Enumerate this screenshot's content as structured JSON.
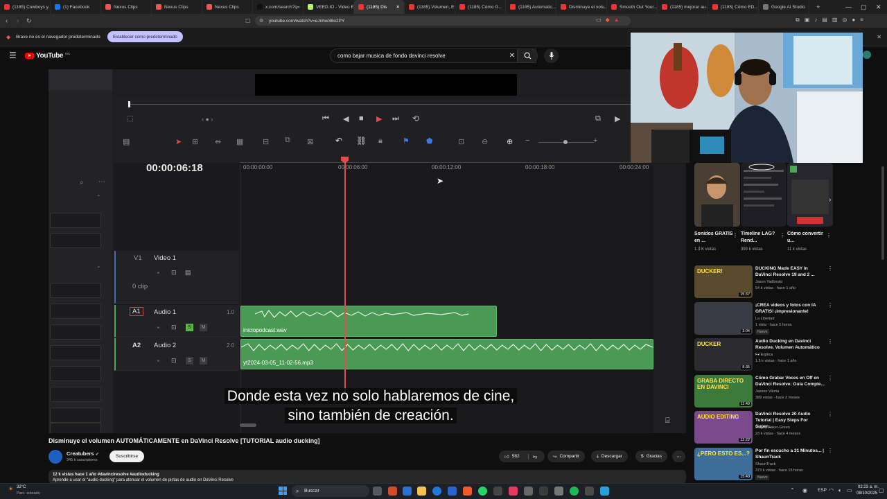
{
  "tabs": [
    {
      "label": "(1185) Cowboys y...",
      "color": "#e33"
    },
    {
      "label": "(1) Facebook",
      "color": "#1877f2"
    },
    {
      "label": "Nexus Clips",
      "color": "#e55"
    },
    {
      "label": "Nexus Clips",
      "color": "#e55"
    },
    {
      "label": "Nexus Clips",
      "color": "#e55"
    },
    {
      "label": "x.com/search?q=",
      "color": "#111"
    },
    {
      "label": "VEED.IO - Video E...",
      "color": "#b6f36a"
    },
    {
      "label": "(1185) Dis",
      "color": "#e33",
      "active": true
    },
    {
      "label": "(1185) Volumen, E...",
      "color": "#e33"
    },
    {
      "label": "(1185) Cómo G...",
      "color": "#e33"
    },
    {
      "label": "(1185) Automatic...",
      "color": "#e33"
    },
    {
      "label": "Disminuye el volu...",
      "color": "#e33"
    },
    {
      "label": "Smooth Out Your...",
      "color": "#e33"
    },
    {
      "label": "(1185) mejorar au...",
      "color": "#e33"
    },
    {
      "label": "(1185) Cómo ED...",
      "color": "#e33"
    },
    {
      "label": "Google AI Studio",
      "color": "#777"
    }
  ],
  "address": {
    "url": "youtube.com/watch?v=eJnhw3Bo2PY"
  },
  "infobar": {
    "message": "Brave no es el navegador predeterminado",
    "button": "Establecer como predeterminado"
  },
  "youtube": {
    "logo": "YouTube",
    "region": "MX",
    "search_query": "como bajar musica de fondo davinci resolve"
  },
  "resolve": {
    "timecode": "00:00:06:18",
    "ruler": [
      "00:00:00:00",
      "00:00:06:00",
      "00:00:12:00",
      "00:00:18:00",
      "00:00:24:00"
    ],
    "tracks": [
      {
        "id": "V1",
        "name": "Video 1",
        "info": "0 clip"
      },
      {
        "id": "A1",
        "name": "Audio 1",
        "level": "1.0",
        "clip": "iniciopodcast.wav"
      },
      {
        "id": "A2",
        "name": "Audio 2",
        "level": "2.0",
        "clip": "yt2024-03-05_11-02-56.mp3"
      }
    ],
    "solo_label": "S",
    "mute_label": "M"
  },
  "subtitles": {
    "line1": "Donde esta vez no solo hablaremos de cine,",
    "line2": "sino también de creación."
  },
  "video": {
    "title": "Disminuye el volumen AUTOMÁTICAMENTE en DaVinci Resolve [TUTORIAL audio ducking]",
    "channel": "Creatubers",
    "subscribers": "345 k suscriptores",
    "subscribe": "Suscribirse",
    "likes": "582",
    "share": "Compartir",
    "download": "Descargar",
    "thanks": "Gracias",
    "desc_line1": "12 k vistas  hace 1 año  #davinciresolve #audioducking",
    "desc_line2": "Aprende a usar el \"audio ducking\" para atenuar el volumen de pistas de audio en DaVinci Resolve"
  },
  "shorts": [
    {
      "title": "Sonidos GRATIS en ...",
      "views": "1.3 K vistas"
    },
    {
      "title": "Timeline LAG? Rend...",
      "views": "393 k vistas"
    },
    {
      "title": "Cómo convertir u...",
      "views": "11 k vistas"
    }
  ],
  "recommended": [
    {
      "title": "DUCKING Made EASY In DaVinci Resolve 19 and 2 ...",
      "channel": "Jason Yadlovski",
      "meta": "54 k vistas · hace 1 año",
      "duration": "15:37",
      "thumb_text": "DUCKER!",
      "color": "#5a4a2e"
    },
    {
      "title": "¡CREA videos y fotos con IA GRATIS! ¡impresionante!",
      "channel": "La Libertad",
      "meta": "1 vista · hace 5 horas",
      "duration": "3:04",
      "badge": "Nuevo",
      "thumb_text": "",
      "color": "#3a3a44"
    },
    {
      "title": "Audio Ducking en Davinci Resolve, Volumen Automático ...",
      "channel": "FJ Explica",
      "meta": "1.5 k vistas · hace 1 año",
      "duration": "8:35",
      "thumb_text": "DUCKER",
      "color": "#2c2c30"
    },
    {
      "title": "Cómo Grabar Voces en Off en DaVinci Resolve: Guía Comple...",
      "channel": "Jasson Viloria",
      "meta": "389 vistas · hace 2 meses",
      "duration": "11:49",
      "thumb_text": "GRABA DIRECTO EN DAVINCI",
      "color": "#3b7a3b"
    },
    {
      "title": "DaVinci Resolve 20 Audio Tutorial | Easy Steps For Super...",
      "channel": "Sidney Baker-Green",
      "meta": "23 k vistas · hace 4 meses",
      "duration": "12:22",
      "thumb_text": "AUDIO EDITING",
      "color": "#7a4a8a"
    },
    {
      "title": "Por fin escucho a 31 Minutos... | ShaunTrack",
      "channel": "ShaunTrack",
      "meta": "373 k vistas · hace 15 horas",
      "duration": "15:49",
      "badge": "Nuevo",
      "thumb_text": "¿PERO ESTO ES...?",
      "color": "#3d6e9a"
    }
  ],
  "taskbar": {
    "weather_temp": "32°C",
    "weather_desc": "Parc. soleado",
    "search": "Buscar",
    "lang": "ESP",
    "time": "02:23 a. m.",
    "date": "08/10/2025"
  }
}
